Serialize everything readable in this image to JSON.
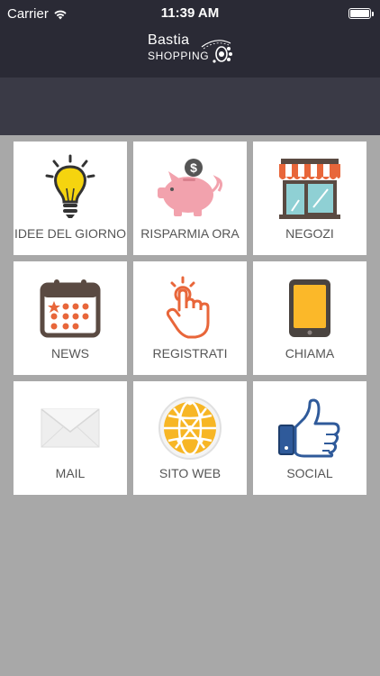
{
  "status_bar": {
    "carrier": "Carrier",
    "time": "11:39 AM"
  },
  "header": {
    "logo_line1": "Bastia",
    "logo_line2": "SHOPPING"
  },
  "colors": {
    "header_bg": "#2a2a35",
    "banner_bg": "#3a3a46",
    "page_bg": "#a8a8a8",
    "tile_bg": "#ffffff",
    "label_text": "#555555"
  },
  "menu": {
    "items": [
      {
        "label": "IDEE DEL GIORNO",
        "icon": "lightbulb-icon"
      },
      {
        "label": "RISPARMIA ORA",
        "icon": "piggy-bank-icon"
      },
      {
        "label": "NEGOZI",
        "icon": "storefront-icon"
      },
      {
        "label": "NEWS",
        "icon": "calendar-icon"
      },
      {
        "label": "REGISTRATI",
        "icon": "pointing-hand-icon"
      },
      {
        "label": "CHIAMA",
        "icon": "tablet-icon"
      },
      {
        "label": "MAIL",
        "icon": "envelope-icon"
      },
      {
        "label": "SITO WEB",
        "icon": "globe-icon"
      },
      {
        "label": "SOCIAL",
        "icon": "thumbs-up-icon"
      }
    ]
  }
}
